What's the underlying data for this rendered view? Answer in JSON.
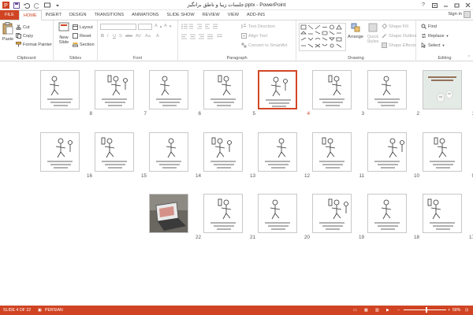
{
  "window": {
    "title": "جلسات زيبا و ناطق برانگيز.pptx - PowerPoint",
    "sign_in": "Sign in"
  },
  "tabs": [
    {
      "label": "FILE"
    },
    {
      "label": "HOME"
    },
    {
      "label": "INSERT"
    },
    {
      "label": "DESIGN"
    },
    {
      "label": "TRANSITIONS"
    },
    {
      "label": "ANIMATIONS"
    },
    {
      "label": "SLIDE SHOW"
    },
    {
      "label": "REVIEW"
    },
    {
      "label": "VIEW"
    },
    {
      "label": "ADD-INS"
    }
  ],
  "active_tab": "HOME",
  "ribbon": {
    "clipboard": {
      "paste": "Paste",
      "cut": "Cut",
      "copy": "Copy",
      "format_painter": "Format Painter",
      "label": "Clipboard"
    },
    "slides": {
      "new_slide_1": "New",
      "new_slide_2": "Slide",
      "layout": "Layout",
      "reset": "Reset",
      "section": "Section",
      "label": "Slides"
    },
    "font": {
      "label": "Font"
    },
    "paragraph": {
      "text_direction": "Text Direction",
      "align_text": "Align Text",
      "convert_smartart": "Convert to SmartArt",
      "label": "Paragraph"
    },
    "drawing": {
      "arrange": "Arrange",
      "quick_styles_1": "Quick",
      "quick_styles_2": "Styles",
      "shape_fill": "Shape Fill",
      "shape_outline": "Shape Outline",
      "shape_effects": "Shape Effects",
      "label": "Drawing"
    },
    "editing": {
      "find": "Find",
      "replace": "Replace",
      "select": "Select",
      "label": "Editing"
    }
  },
  "slides": [
    {
      "number": "1",
      "kind": "title"
    },
    {
      "number": "2",
      "kind": "figure"
    },
    {
      "number": "3",
      "kind": "figure"
    },
    {
      "number": "4",
      "kind": "figure",
      "selected": true
    },
    {
      "number": "5",
      "kind": "figure"
    },
    {
      "number": "6",
      "kind": "figure"
    },
    {
      "number": "7",
      "kind": "figure"
    },
    {
      "number": "8",
      "kind": "figure"
    },
    {
      "number": "9",
      "kind": "figure"
    },
    {
      "number": "10",
      "kind": "figure"
    },
    {
      "number": "11",
      "kind": "figure"
    },
    {
      "number": "12",
      "kind": "figure"
    },
    {
      "number": "13",
      "kind": "figure"
    },
    {
      "number": "14",
      "kind": "figure"
    },
    {
      "number": "15",
      "kind": "figure"
    },
    {
      "number": "16",
      "kind": "figure"
    },
    {
      "number": "17",
      "kind": "figure"
    },
    {
      "number": "18",
      "kind": "figure"
    },
    {
      "number": "19",
      "kind": "figure"
    },
    {
      "number": "20",
      "kind": "figure"
    },
    {
      "number": "21",
      "kind": "figure"
    },
    {
      "number": "22",
      "kind": "photo"
    }
  ],
  "status": {
    "slide_info": "SLIDE 4 OF 22",
    "language": "PERSIAN",
    "zoom": "58%"
  },
  "colors": {
    "accent": "#d04423",
    "selection": "#d24726"
  }
}
